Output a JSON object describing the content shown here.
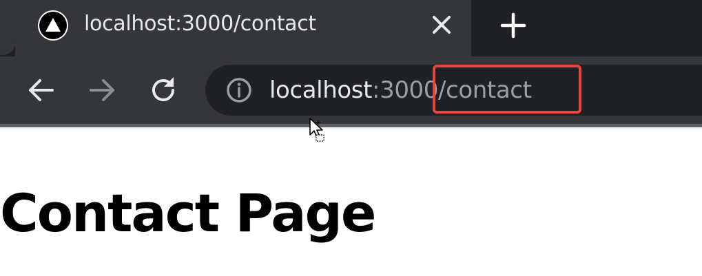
{
  "browser": {
    "tab": {
      "title": "localhost:3000/contact",
      "favicon": "vercel-triangle-icon",
      "close_icon": "close-icon"
    },
    "new_tab_icon": "plus-icon",
    "nav": {
      "back_icon": "arrow-left-icon",
      "forward_icon": "arrow-right-icon",
      "reload_icon": "reload-icon"
    },
    "address_bar": {
      "info_icon": "info-icon",
      "host": "localhost",
      "port": ":3000",
      "path": "/contact"
    },
    "highlight_color": "#e8453c"
  },
  "page": {
    "heading": "Contact Page"
  },
  "colors": {
    "tabstrip": "#202124",
    "active_tab": "#35363a",
    "omnibox": "#202124",
    "text_primary": "#e8eaed",
    "text_muted": "#9aa0a6"
  }
}
